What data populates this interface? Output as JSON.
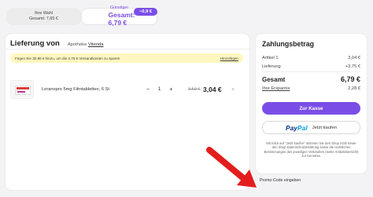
{
  "tabs": [
    {
      "label": "Ihre Wahl",
      "sub": "Gesamt: 7,65 €"
    },
    {
      "label": "Günstiger",
      "sub": "Gesamt: 6,79 €"
    }
  ],
  "savings_badge": "−0,9 €",
  "delivery": {
    "title": "Lieferung von",
    "pharmacy_prefix": "Apotheke",
    "pharmacy_name": "Vitenda"
  },
  "shipping_note": {
    "text": "Fügen Sie 30,96 € hinzu, um die 3,75 € Versandkosten zu sparen",
    "link_label": "Hinzufügen"
  },
  "product": {
    "name": "Loranopro 5mg Filmtabletten, 6 St",
    "quantity": "1",
    "old_price": "3,59 €",
    "price": "3,04 €",
    "minus_label": "−",
    "plus_label": "+",
    "remove_label": "×",
    "image_icon": "medicine-box-icon"
  },
  "summary": {
    "title": "Zahlungsbetrag",
    "rows": {
      "articles": {
        "label": "Artikel 1",
        "value": "3,04 €"
      },
      "delivery": {
        "label": "Lieferung",
        "value": "+3,75 €"
      },
      "total": {
        "label": "Gesamt",
        "value": "6,79 €"
      },
      "savings": {
        "label": "Ihre Ersparnis",
        "value": "2,28 €"
      }
    }
  },
  "buttons": {
    "checkout": "Zur Kasse",
    "paypal_brand_a": "Pay",
    "paypal_brand_b": "Pal",
    "paypal_text": "Jetzt kaufen"
  },
  "legal_text": "Mit Klick auf \"Jetzt kaufen\" stimmen Sie den Shop AGB sowie den Shop Datenschutzerklärung sowie die rechtlichen Bestimmungen des jeweiligen Verkäufers (siehe Artikelübersicht) zur Kenntnis.",
  "promo": "Promo-Code eingeben",
  "colors": {
    "accent": "#7a4ee6",
    "arrow": "#e31d1d"
  }
}
